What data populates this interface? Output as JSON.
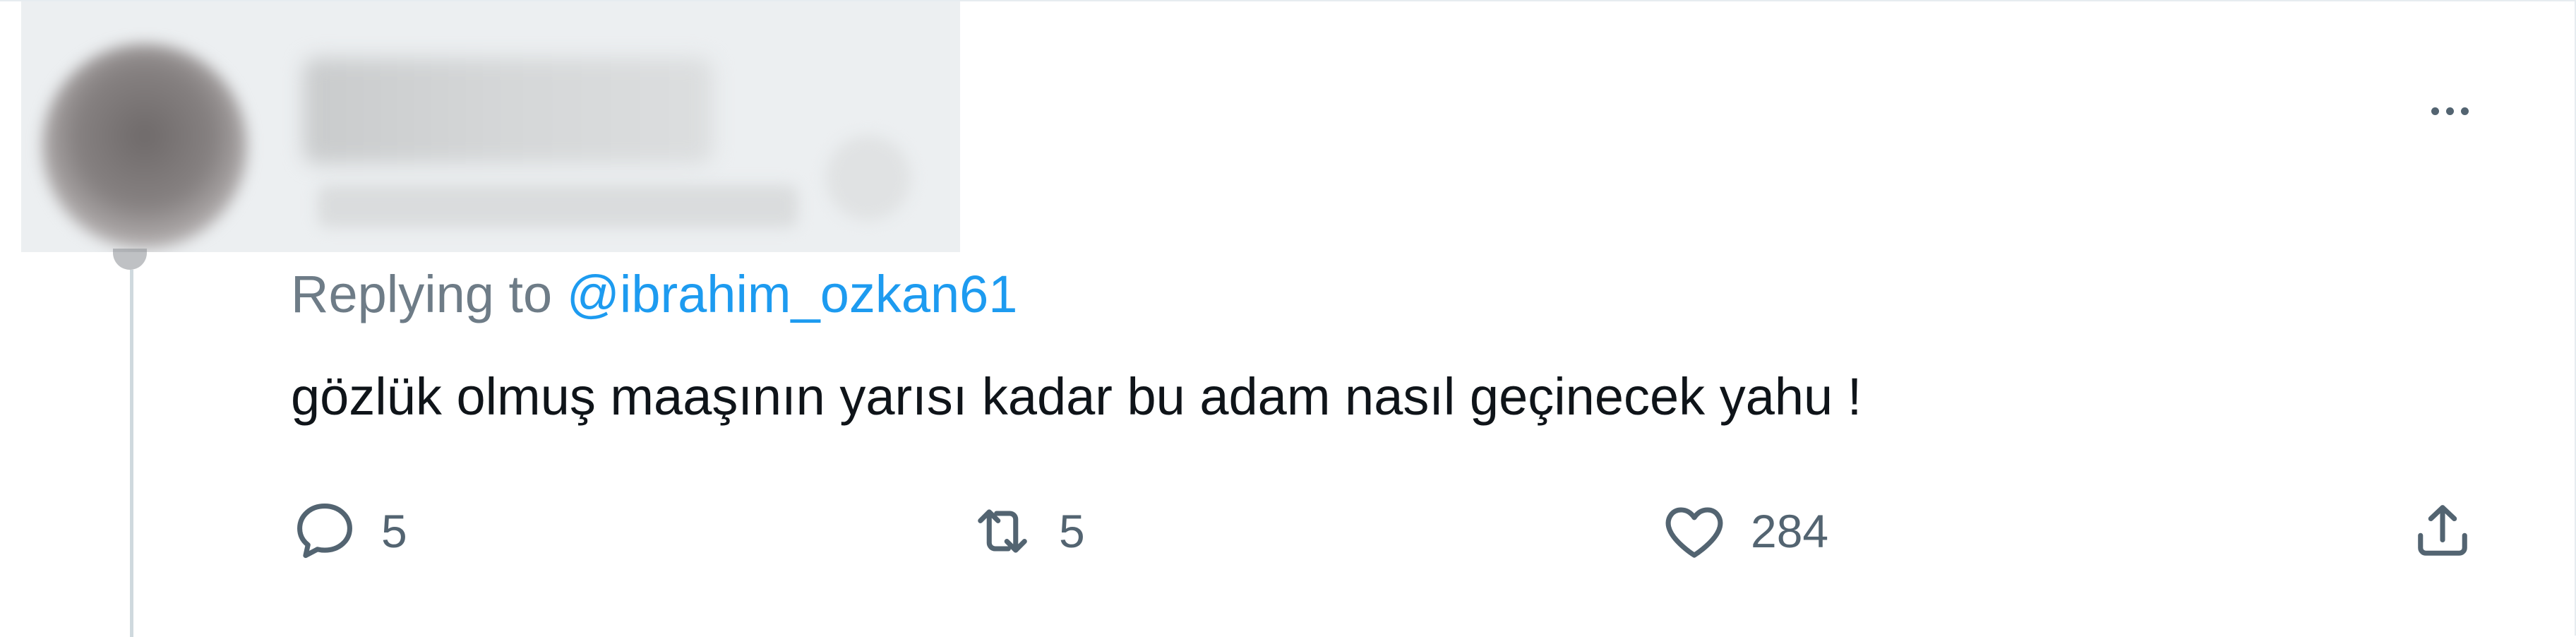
{
  "tweet": {
    "replying_prefix": "Replying to ",
    "replying_handle": "@ibrahim_ozkan61",
    "text": "gözlük olmuş maaşının yarısı kadar bu adam nasıl geçinecek yahu !",
    "actions": {
      "reply_count": "5",
      "retweet_count": "5",
      "like_count": "284"
    },
    "icons": {
      "reply": "reply-icon",
      "retweet": "retweet-icon",
      "like": "heart-icon",
      "share": "share-icon",
      "more": "more-icon"
    },
    "colors": {
      "link": "#1d9bf0",
      "text": "#0f1419",
      "muted": "#536471",
      "thread_line": "#cfd9de"
    }
  }
}
